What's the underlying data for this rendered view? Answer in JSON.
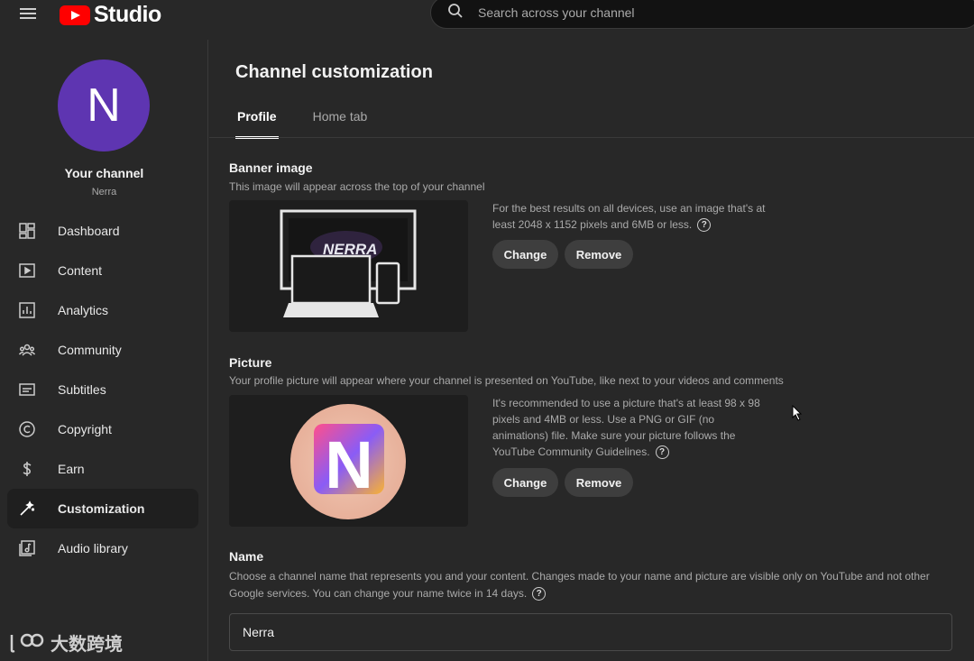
{
  "header": {
    "app_name": "Studio",
    "search_placeholder": "Search across your channel"
  },
  "sidebar": {
    "avatar_letter": "N",
    "channel_title": "Your channel",
    "channel_handle": "Nerra",
    "items": [
      {
        "label": "Dashboard",
        "icon": "dashboard-icon"
      },
      {
        "label": "Content",
        "icon": "content-icon"
      },
      {
        "label": "Analytics",
        "icon": "analytics-icon"
      },
      {
        "label": "Community",
        "icon": "community-icon"
      },
      {
        "label": "Subtitles",
        "icon": "subtitles-icon"
      },
      {
        "label": "Copyright",
        "icon": "copyright-icon"
      },
      {
        "label": "Earn",
        "icon": "earn-icon"
      },
      {
        "label": "Customization",
        "icon": "customization-icon",
        "active": true
      },
      {
        "label": "Audio library",
        "icon": "audio-library-icon"
      }
    ]
  },
  "watermark": "大数跨境",
  "main": {
    "title": "Channel customization",
    "tabs": [
      {
        "label": "Profile",
        "active": true
      },
      {
        "label": "Home tab",
        "active": false
      }
    ],
    "banner": {
      "title": "Banner image",
      "description": "This image will appear across the top of your channel",
      "preview_text": "NERRA",
      "hint": "For the best results on all devices, use an image that's at least 2048 x 1152 pixels and 6MB or less.",
      "change_label": "Change",
      "remove_label": "Remove"
    },
    "picture": {
      "title": "Picture",
      "description": "Your profile picture will appear where your channel is presented on YouTube, like next to your videos and comments",
      "preview_letter": "N",
      "hint": "It's recommended to use a picture that's at least 98 x 98 pixels and 4MB or less. Use a PNG or GIF (no animations) file. Make sure your picture follows the YouTube Community Guidelines.",
      "change_label": "Change",
      "remove_label": "Remove"
    },
    "name": {
      "title": "Name",
      "description": "Choose a channel name that represents you and your content. Changes made to your name and picture are visible only on YouTube and not other Google services. You can change your name twice in 14 days.",
      "value": "Nerra"
    }
  },
  "colors": {
    "background": "#282828",
    "brand_red": "#ff0000",
    "avatar_purple": "#5e35b1"
  }
}
